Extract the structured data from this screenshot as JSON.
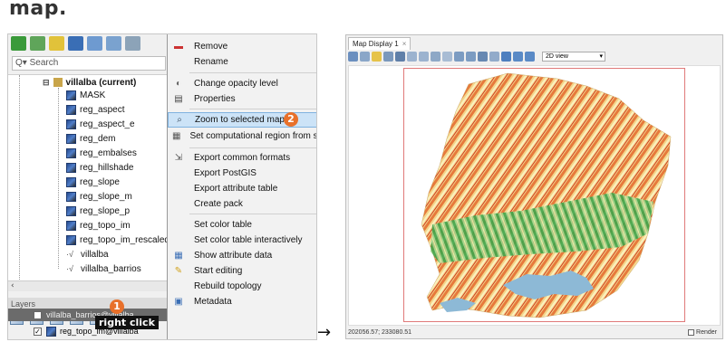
{
  "heading": "map.",
  "search": {
    "placeholder": "Search",
    "prefix": "Q▾"
  },
  "tree": {
    "mapset": "villalba  (current)",
    "maps": [
      "MASK",
      "reg_aspect",
      "reg_aspect_e",
      "reg_dem",
      "reg_embalses",
      "reg_hillshade",
      "reg_slope",
      "reg_slope_m",
      "reg_slope_p",
      "reg_topo_im",
      "reg_topo_im_rescaled"
    ],
    "vectors": [
      "villalba",
      "villalba_barrios"
    ]
  },
  "layers": {
    "title": "Layers",
    "rows": [
      {
        "label": "villalba_barrios@villalba",
        "checked": false
      },
      {
        "label": "reg_topo_im@villalba",
        "checked": true
      }
    ]
  },
  "context_menu": {
    "items": [
      {
        "label": "Remove",
        "icon": "remove-icon"
      },
      {
        "label": "Rename",
        "icon": ""
      },
      {
        "label": "Change opacity level",
        "icon": "opacity-icon"
      },
      {
        "label": "Properties",
        "icon": "properties-icon"
      },
      {
        "label": "Zoom to selected map(s)",
        "icon": "zoom-icon",
        "highlighted": true
      },
      {
        "label": "Set computational region from se",
        "icon": "region-icon"
      },
      {
        "label": "Export common formats",
        "icon": "export-icon"
      },
      {
        "label": "Export PostGIS",
        "icon": ""
      },
      {
        "label": "Export attribute table",
        "icon": ""
      },
      {
        "label": "Create pack",
        "icon": ""
      },
      {
        "label": "Set color table",
        "icon": ""
      },
      {
        "label": "Set color table interactively",
        "icon": ""
      },
      {
        "label": "Show attribute data",
        "icon": "table-icon"
      },
      {
        "label": "Start editing",
        "icon": "pencil-icon"
      },
      {
        "label": "Rebuild topology",
        "icon": ""
      },
      {
        "label": "Metadata",
        "icon": "metadata-icon"
      }
    ]
  },
  "annotations": {
    "step1": "1",
    "step2": "2",
    "right_click": "right click",
    "accent": "#e8702a"
  },
  "arrow": "→",
  "map_display": {
    "tab": "Map Display 1",
    "tab_close": "×",
    "view_mode": "2D view",
    "coordinates": "202056.57; 233080.51",
    "render_label": "Render"
  }
}
